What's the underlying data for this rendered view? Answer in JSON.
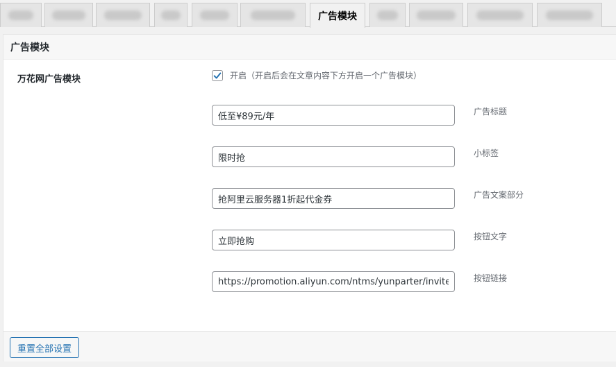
{
  "tabs": {
    "active_label": "广告模块"
  },
  "section": {
    "title": "广告模块",
    "row_label": "万花网广告模块"
  },
  "enable": {
    "checked": true,
    "label": "开启（开启后会在文章内容下方开启一个广告模块）"
  },
  "fields": [
    {
      "value": "低至¥89元/年",
      "desc": "广告标题"
    },
    {
      "value": "限时抢",
      "desc": "小标签"
    },
    {
      "value": "抢阿里云服务器1折起代金券",
      "desc": "广告文案部分"
    },
    {
      "value": "立即抢购",
      "desc": "按钮文字"
    },
    {
      "value": "https://promotion.aliyun.com/ntms/yunparter/invite.html",
      "desc": "按钮链接"
    }
  ],
  "footer": {
    "reset_label": "重置全部设置"
  },
  "colors": {
    "accent": "#2271b1",
    "checkmark": "#2271b1"
  }
}
